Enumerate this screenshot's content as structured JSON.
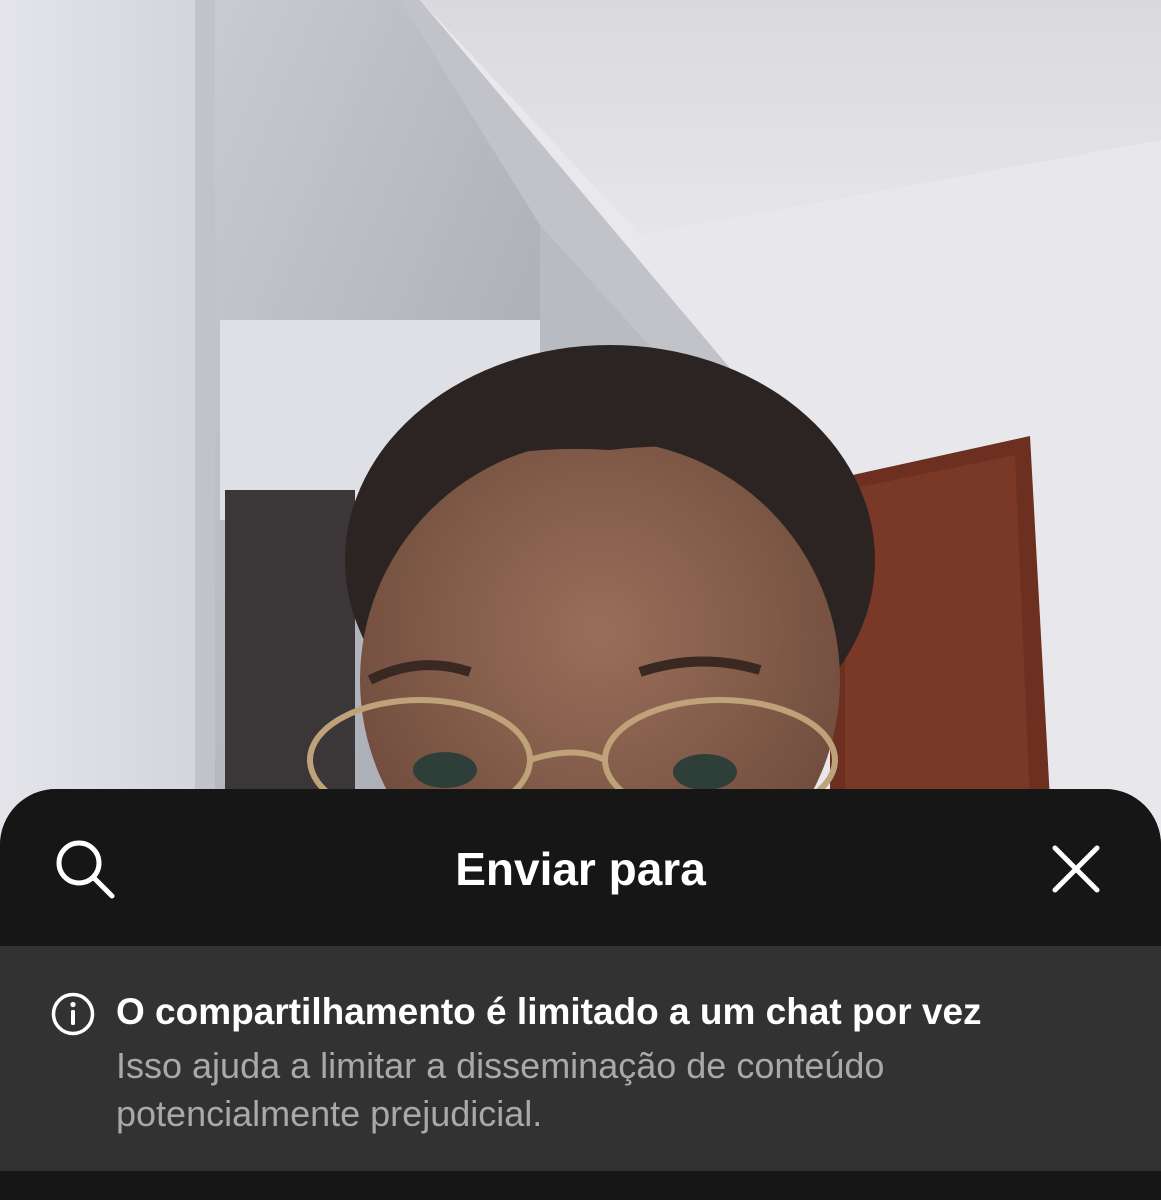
{
  "video": {
    "description_icon": "video-frame"
  },
  "share_sheet": {
    "title": "Enviar para",
    "search_icon": "search-icon",
    "close_icon": "close-icon",
    "notice": {
      "icon": "info-icon",
      "title": "O compartilhamento é limitado a um chat por vez",
      "body": "Isso ajuda a limitar a disseminação de conteúdo potencialmente prejudicial."
    }
  },
  "colors": {
    "sheet_background": "#161616",
    "notice_background": "#323232",
    "title_text": "#ffffff",
    "body_text": "#a9a9a9"
  }
}
